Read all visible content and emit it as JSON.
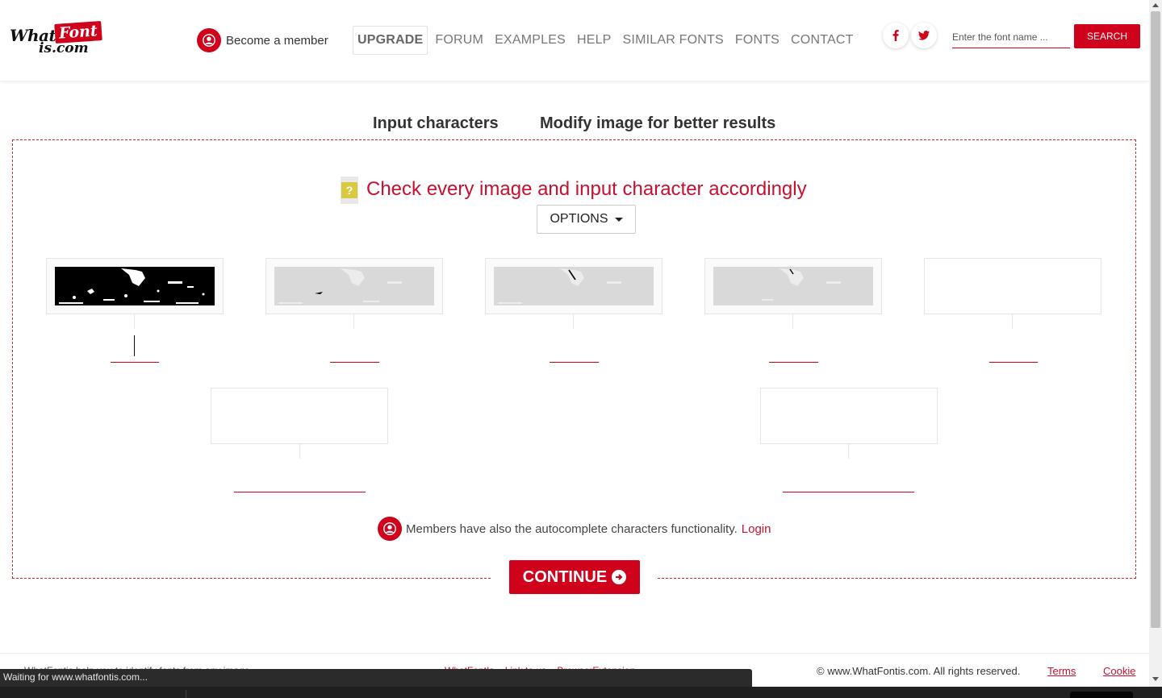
{
  "header": {
    "logo": {
      "word1": "What",
      "word2": "Font",
      "word3": "is.com"
    },
    "become_member": "Become a member",
    "nav": [
      "UPGRADE",
      "FORUM",
      "EXAMPLES",
      "HELP",
      "SIMILAR FONTS",
      "FONTS",
      "CONTACT"
    ],
    "search_placeholder": "Enter the font name ...",
    "search_button": "SEARCH"
  },
  "tabs": {
    "input_characters": "Input characters",
    "modify_image": "Modify image for better results"
  },
  "main": {
    "help_glyph": "?",
    "instruction": "Check every image and input character accordingly",
    "options_label": "OPTIONS",
    "characters": [
      {
        "image_style": "black",
        "value": ""
      },
      {
        "image_style": "light",
        "value": ""
      },
      {
        "image_style": "light",
        "value": ""
      },
      {
        "image_style": "light",
        "value": ""
      },
      {
        "image_style": "empty",
        "value": ""
      },
      {
        "image_style": "empty",
        "value": ""
      },
      {
        "image_style": "empty",
        "value": ""
      }
    ],
    "members_note": "Members have also the autocomplete characters functionality.",
    "login_label": "Login",
    "continue_label": "CONTINUE"
  },
  "footer": {
    "left_text": "WhatFontis help you to identify fonts from any image",
    "links": [
      "WhatFontIs",
      "Link to us",
      "BrowserExtension"
    ],
    "copyright": "© www.WhatFontis.com. All rights reserved.",
    "terms": "Terms",
    "cookie": "Cookie"
  },
  "status_bar": "Waiting for www.whatfontis.com...",
  "colors": {
    "brand_red": "#d0021b",
    "instruction_red": "#c8102e",
    "help_yellow": "#d8c93f"
  },
  "icons": {
    "member": "user-icon",
    "facebook": "facebook-icon",
    "twitter": "twitter-icon",
    "help": "question-icon",
    "continue": "arrow-right-circle-icon"
  }
}
